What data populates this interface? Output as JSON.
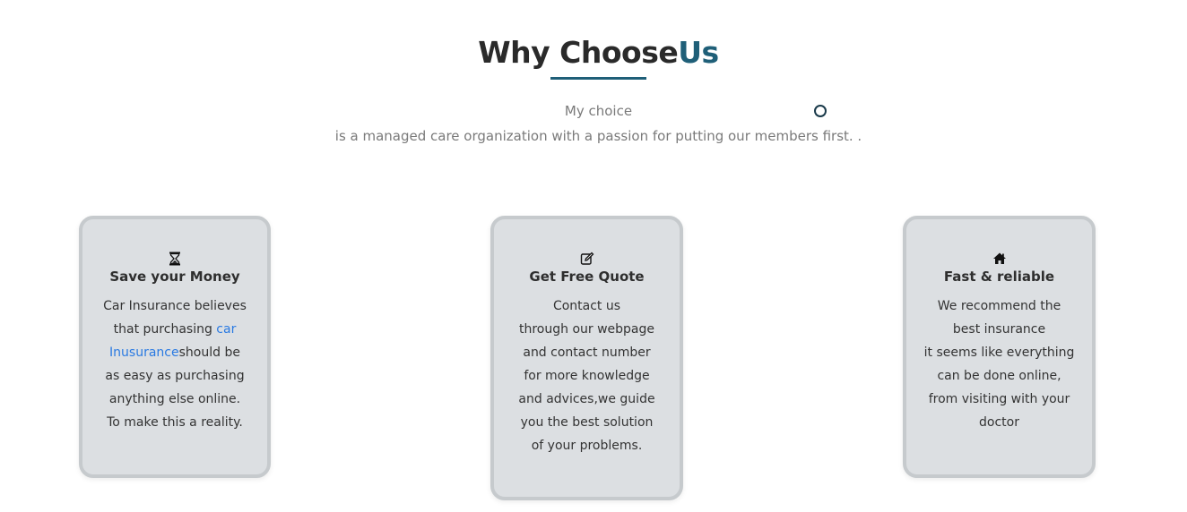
{
  "header": {
    "title_main": "Why Choose",
    "title_accent": "Us",
    "subtitle_line1": "My choice",
    "subtitle_line2": "is a managed care organization with a passion for putting our members first. ."
  },
  "colors": {
    "accent": "#1f5f78",
    "card_bg": "#dcdfe2",
    "link": "#2a7ae2"
  },
  "cards": [
    {
      "icon": "hourglass-icon",
      "title": "Save your Money",
      "body_line1": "Car Insurance believes",
      "body_before_link": "that purchasing ",
      "link_text": "car Inusurance",
      "body_after_link": "should be",
      "body_line4": "as easy as purchasing",
      "body_line5": "anything else online.",
      "body_line6": "To make this a reality."
    },
    {
      "icon": "edit-icon",
      "title": "Get Free Quote",
      "lines": [
        "Contact us",
        "through our webpage",
        "and contact number",
        "for more knowledge",
        "and advices,we guide",
        "you the best solution",
        "of your problems."
      ]
    },
    {
      "icon": "home-icon",
      "title": "Fast & reliable",
      "lines": [
        "We recommend the",
        "best insurance",
        "it seems like everything",
        "can be done online,",
        "from visiting with your",
        "doctor"
      ]
    }
  ]
}
